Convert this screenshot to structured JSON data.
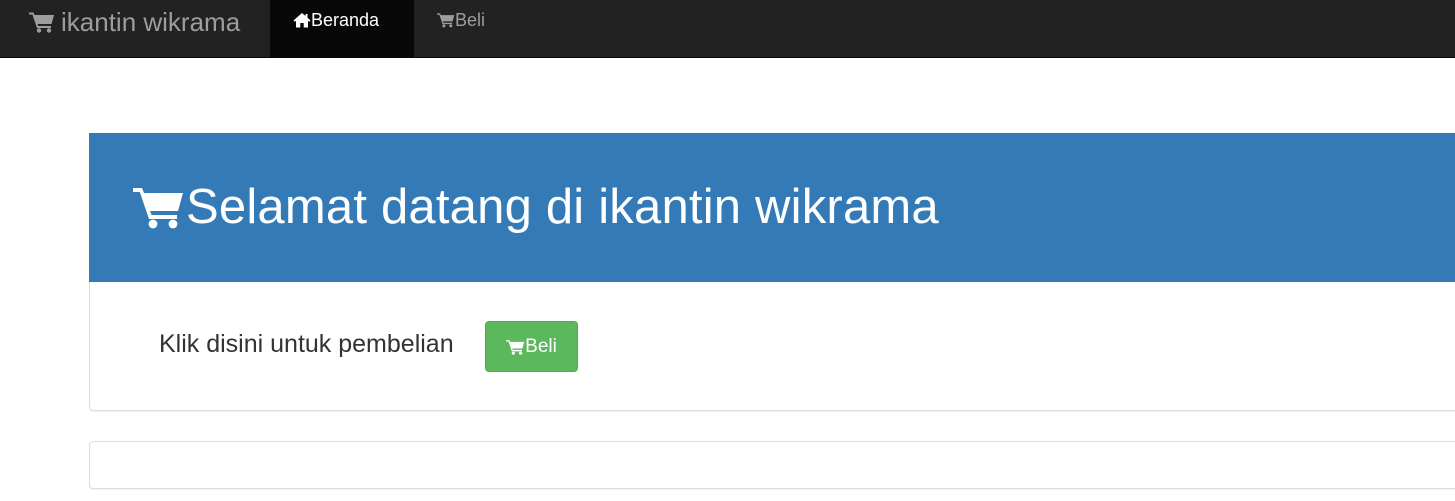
{
  "navbar": {
    "brand": {
      "icon": "shopping-cart-icon",
      "label": "ikantin wikrama"
    },
    "items": [
      {
        "icon": "home-icon",
        "label": "Beranda",
        "active": true
      },
      {
        "icon": "shopping-cart-icon",
        "label": "Beli",
        "active": false
      }
    ]
  },
  "jumbotron": {
    "icon": "shopping-cart-icon",
    "title": "Selamat datang di ikantin wikrama"
  },
  "panel": {
    "text": "Klik disini untuk pembelian",
    "button": {
      "icon": "shopping-cart-icon",
      "label": "Beli"
    }
  },
  "colors": {
    "navbar_bg": "#222222",
    "navbar_active_bg": "#080808",
    "navbar_text": "#9d9d9d",
    "jumbotron_bg": "#337ab7",
    "button_success": "#5cb85c"
  }
}
